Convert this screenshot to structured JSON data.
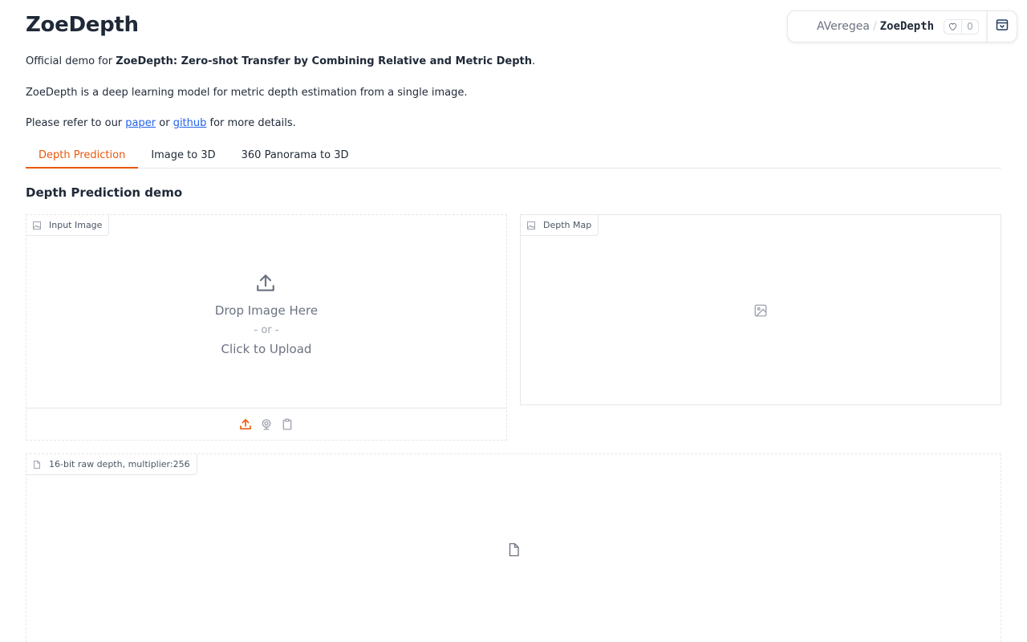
{
  "page": {
    "title": "ZoeDepth"
  },
  "hf_badge": {
    "owner": "AVeregea",
    "separator": "/",
    "repo": "ZoeDepth",
    "likes": "0"
  },
  "intro": {
    "line1_prefix": "Official demo for ",
    "line1_bold": "ZoeDepth: Zero-shot Transfer by Combining Relative and Metric Depth",
    "line1_suffix": ".",
    "line2": "ZoeDepth is a deep learning model for metric depth estimation from a single image.",
    "line3_prefix": "Please refer to our ",
    "link_paper": "paper",
    "line3_middle": " or ",
    "link_github": "github",
    "line3_suffix": " for more details."
  },
  "tabs": [
    {
      "label": "Depth Prediction",
      "active": true
    },
    {
      "label": "Image to 3D",
      "active": false
    },
    {
      "label": "360 Panorama to 3D",
      "active": false
    }
  ],
  "section": {
    "title": "Depth Prediction demo"
  },
  "input_image": {
    "label": "Input Image",
    "drop_text": "Drop Image Here",
    "or_text": "- or -",
    "click_text": "Click to Upload"
  },
  "depth_map": {
    "label": "Depth Map"
  },
  "raw_depth": {
    "label": "16-bit raw depth, multiplier:256"
  },
  "colors": {
    "accent": "#ea580c",
    "link": "#2563eb",
    "border": "#e5e7eb"
  }
}
